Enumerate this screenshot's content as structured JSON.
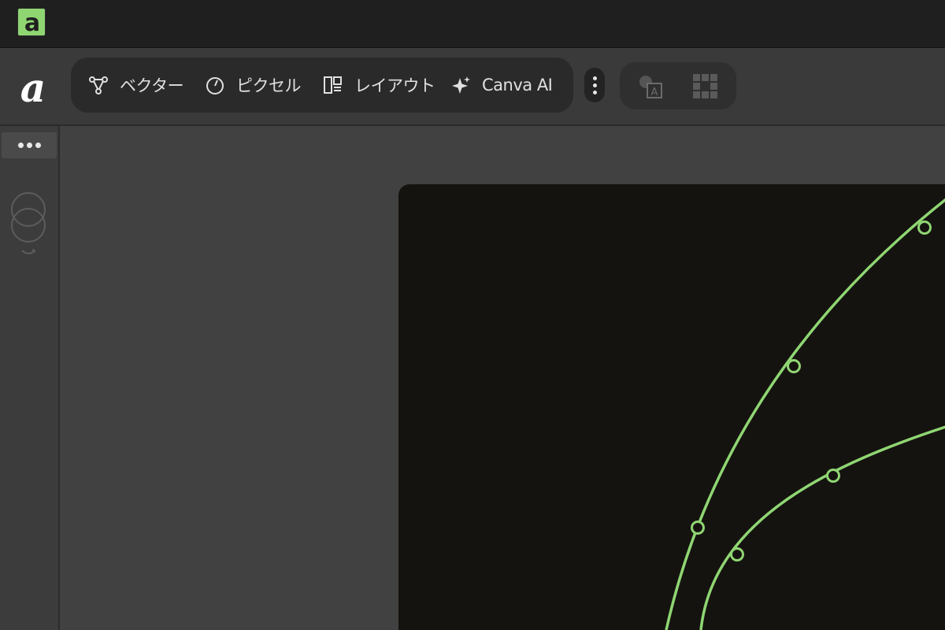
{
  "titlebar": {
    "app_icon": "affinity-logo-icon"
  },
  "toolbar": {
    "brand": "affinity-brand-mark",
    "personas": [
      {
        "label": "ベクター",
        "icon": "vector-nodes-icon"
      },
      {
        "label": "ピクセル",
        "icon": "pixel-brush-icon"
      },
      {
        "label": "レイアウト",
        "icon": "layout-icon"
      },
      {
        "label": "Canva AI",
        "icon": "sparkle-icon"
      }
    ],
    "more_icon": "more-vertical-icon",
    "tools": [
      {
        "icon": "text-frame-icon"
      },
      {
        "icon": "grid-icon"
      }
    ]
  },
  "left_panel": {
    "menu_icon": "more-horizontal-icon",
    "blend_icon": "blend-mode-icon"
  },
  "canvas": {
    "background": "#15130f",
    "curve_color": "#8fd673"
  }
}
